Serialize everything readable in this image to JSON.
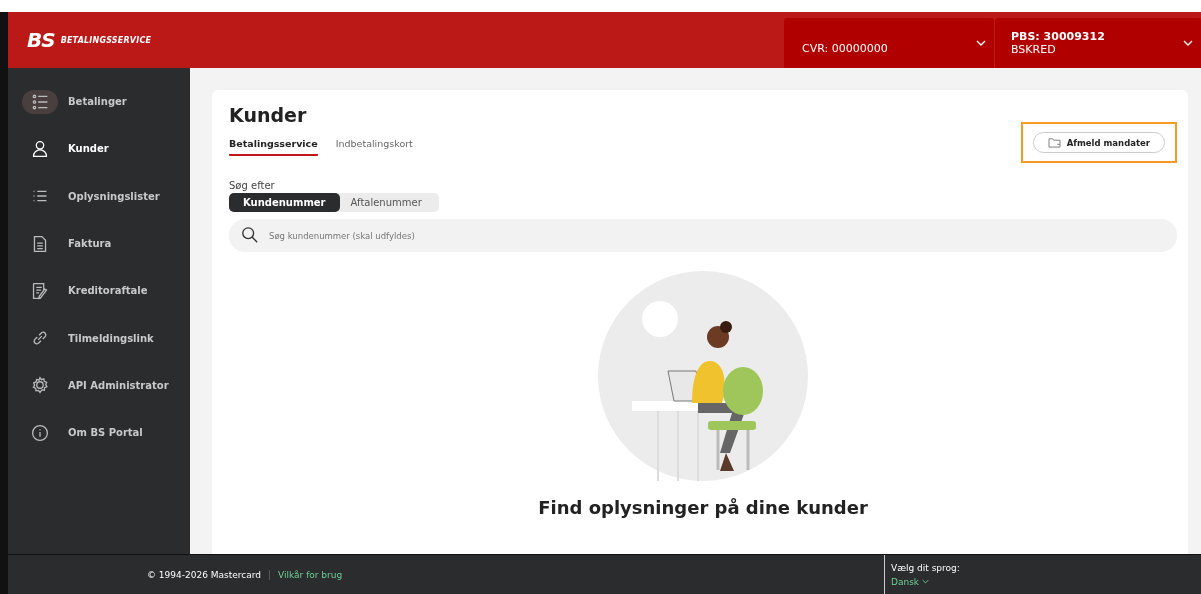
{
  "header": {
    "logo_mark": "BS",
    "logo_text": "BETALINGSSERVICE",
    "selectors": [
      {
        "kind": "cvr",
        "value": "CVR: 00000000"
      },
      {
        "kind": "pbs",
        "title": "PBS: 30009312",
        "value": "BSKRED"
      }
    ]
  },
  "sidebar": {
    "items": [
      {
        "label": "Betalinger",
        "selected": false,
        "hovered": true
      },
      {
        "label": "Kunder",
        "selected": true,
        "hovered": false
      },
      {
        "label": "Oplysningslister",
        "selected": false,
        "hovered": false
      },
      {
        "label": "Faktura",
        "selected": false,
        "hovered": false
      },
      {
        "label": "Kreditoraftale",
        "selected": false,
        "hovered": false
      },
      {
        "label": "Tilmeldingslink",
        "selected": false,
        "hovered": false
      },
      {
        "label": "API Administrator",
        "selected": false,
        "hovered": false
      },
      {
        "label": "Om BS Portal",
        "selected": false,
        "hovered": false
      }
    ]
  },
  "page": {
    "title": "Kunder",
    "tabs": [
      {
        "label": "Betalingsservice",
        "selected": true
      },
      {
        "label": "Indbetalingskort",
        "selected": false
      }
    ],
    "action_button": {
      "label": "Afmeld mandater",
      "highlighted": true
    },
    "search_by_label": "Søg efter",
    "search_by": [
      {
        "label": "Kundenummer",
        "selected": true
      },
      {
        "label": "Aftalenummer",
        "selected": false
      }
    ],
    "search": {
      "placeholder": "Søg kundenummer (skal udfyldes)"
    },
    "empty_state": {
      "kind": "picture",
      "heading": "Find oplysninger på dine kunder"
    }
  },
  "footer": {
    "copyright": "© 1994-2026 Mastercard",
    "terms_link": "Vilkår for brug",
    "language_label": "Vælg dit sprog:",
    "language": "Dansk"
  }
}
